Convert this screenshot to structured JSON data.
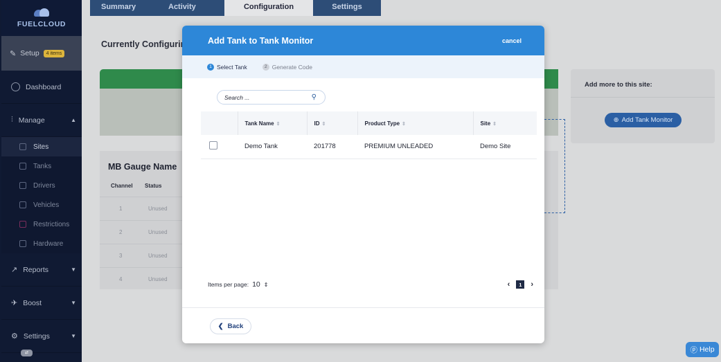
{
  "brand": {
    "name": "FUELCLOUD"
  },
  "sidebar": {
    "setup": {
      "label": "Setup",
      "badge": "4 items"
    },
    "items": [
      {
        "label": "Dashboard"
      },
      {
        "label": "Manage"
      },
      {
        "label": "Reports"
      },
      {
        "label": "Boost"
      },
      {
        "label": "Settings"
      }
    ],
    "manage_sub": [
      {
        "label": "Sites"
      },
      {
        "label": "Tanks"
      },
      {
        "label": "Drivers"
      },
      {
        "label": "Vehicles"
      },
      {
        "label": "Restrictions"
      },
      {
        "label": "Hardware"
      }
    ]
  },
  "tabs": [
    {
      "label": "Summary"
    },
    {
      "label": "Activity"
    },
    {
      "label": "Configuration"
    },
    {
      "label": "Settings"
    }
  ],
  "background": {
    "title": "Currently Configuring",
    "gauge_title": "MB Gauge Name",
    "gauge_headers": [
      "Channel",
      "Status"
    ],
    "gauge_rows": [
      {
        "channel": "1",
        "status": "Unused"
      },
      {
        "channel": "2",
        "status": "Unused"
      },
      {
        "channel": "3",
        "status": "Unused"
      },
      {
        "channel": "4",
        "status": "Unused"
      }
    ],
    "right_card_title": "Add more to this site:",
    "add_monitor_label": "Add Tank Monitor"
  },
  "modal": {
    "title": "Add Tank to Tank Monitor",
    "cancel_label": "cancel",
    "steps": [
      {
        "num": "1",
        "label": "Select Tank"
      },
      {
        "num": "2",
        "label": "Generate Code"
      }
    ],
    "search_placeholder": "Search ...",
    "columns": [
      "Tank Name",
      "ID",
      "Product Type",
      "Site"
    ],
    "rows": [
      {
        "tank_name": "Demo Tank",
        "id": "201778",
        "product_type": "PREMIUM UNLEADED",
        "site": "Demo Site"
      }
    ],
    "items_per_page_label": "Items per page:",
    "items_per_page_value": "10",
    "current_page": "1",
    "back_label": "Back"
  },
  "help_label": "Help",
  "colors": {
    "accent": "#2d87d8",
    "sidebar": "#101a33",
    "brand_blue": "#2b5fa4"
  }
}
